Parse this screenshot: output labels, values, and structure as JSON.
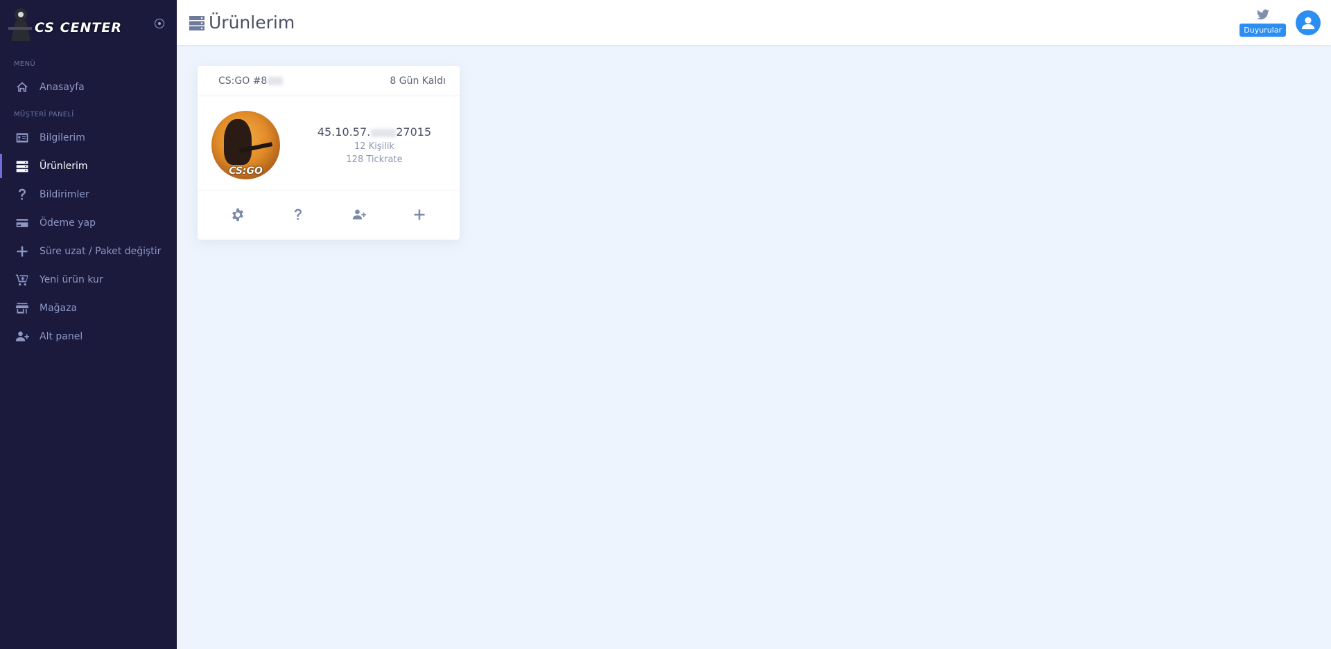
{
  "brand": {
    "name": "CS CENTER"
  },
  "sidebar": {
    "sections": [
      {
        "label": "MENÜ"
      },
      {
        "label": "MÜŞTERİ PANELİ"
      }
    ],
    "items": [
      {
        "label": "Anasayfa",
        "icon": "home-icon"
      },
      {
        "label": "Bilgilerim",
        "icon": "id-card-icon"
      },
      {
        "label": "Ürünlerim",
        "icon": "server-icon",
        "active": true
      },
      {
        "label": "Bildirimler",
        "icon": "question-icon"
      },
      {
        "label": "Ödeme yap",
        "icon": "credit-card-icon"
      },
      {
        "label": "Süre uzat / Paket değiştir",
        "icon": "plus-icon"
      },
      {
        "label": "Yeni ürün kur",
        "icon": "cart-icon"
      },
      {
        "label": "Mağaza",
        "icon": "store-icon"
      },
      {
        "label": "Alt panel",
        "icon": "user-plus-icon"
      }
    ]
  },
  "header": {
    "title": "Ürünlerim",
    "announcements_label": "Duyurular"
  },
  "product_card": {
    "name_prefix": "CS:GO #8",
    "days_left": "8 Gün Kaldı",
    "game_logo": "CS:GO",
    "ip_prefix": "45.10.57.",
    "ip_port": "27015",
    "slots": "12 Kişilik",
    "tickrate": "128 Tickrate",
    "actions": [
      "settings-icon",
      "help-icon",
      "add-user-icon",
      "plus-icon"
    ]
  },
  "colors": {
    "sidebar_bg": "#1b1a3d",
    "accent": "#2c8ef0",
    "active_indicator": "#6f6bd8",
    "page_bg": "#eef4fd"
  }
}
